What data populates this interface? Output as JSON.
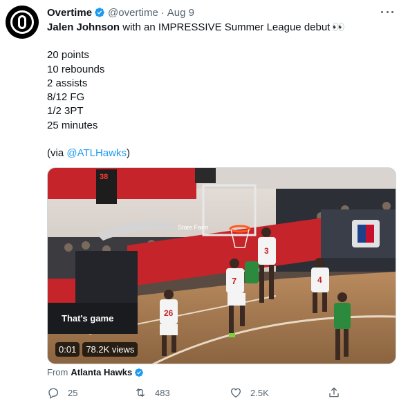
{
  "tweet": {
    "display_name": "Overtime",
    "handle": "@overtime",
    "separator": "·",
    "date": "Aug 9",
    "headline_name": "Jalen Johnson",
    "headline_rest": " with an IMPRESSIVE Summer League debut",
    "headline_emoji": "👀",
    "stats": [
      "20 points",
      "10 rebounds",
      "2 assists",
      "8/12 FG",
      "1/2 3PT",
      "25 minutes"
    ],
    "via_prefix": "(via ",
    "via_mention": "@ATLHawks",
    "via_suffix": ")"
  },
  "media": {
    "timestamp": "0:01",
    "views": "78.2K views",
    "scoreboard_text": "38",
    "banner_text": "State Farm",
    "court_text": "That's game",
    "jersey_numbers": [
      "26",
      "7",
      "3",
      "4"
    ]
  },
  "source": {
    "prefix": "From",
    "name": "Atlanta Hawks"
  },
  "actions": {
    "replies": "25",
    "retweets": "483",
    "likes": "2.5K"
  },
  "icons": {
    "verified": "verified-badge-icon",
    "more": "more-icon",
    "reply": "reply-icon",
    "retweet": "retweet-icon",
    "like": "heart-icon",
    "share": "share-icon"
  },
  "colors": {
    "verified_blue": "#1d9bf0",
    "text_primary": "#0f1419",
    "text_secondary": "#536471"
  }
}
